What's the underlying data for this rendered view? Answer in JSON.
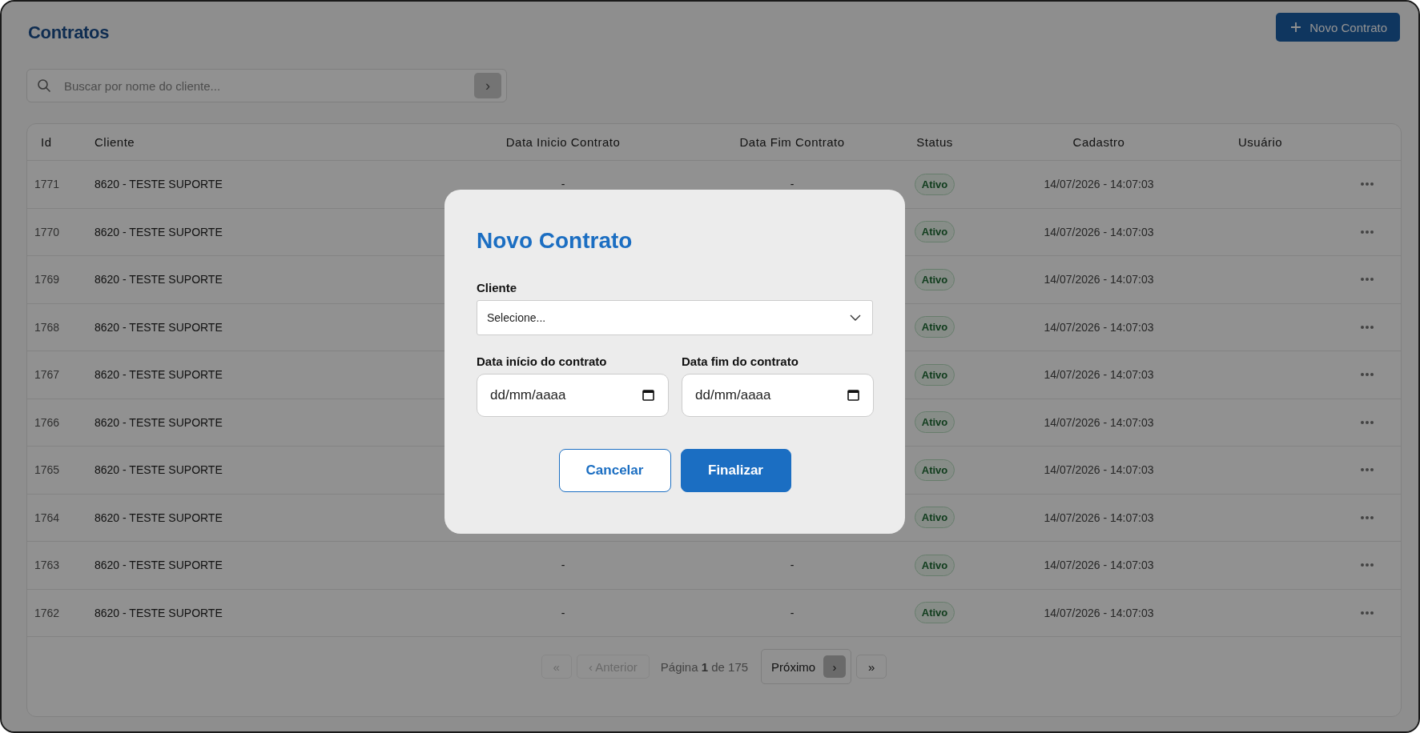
{
  "page": {
    "title": "Contratos",
    "new_button": {
      "label": "Novo Contrato"
    }
  },
  "search": {
    "placeholder": "Buscar por nome do cliente...",
    "go": "›"
  },
  "table": {
    "columns": [
      "Id",
      "Cliente",
      "Data Inicio Contrato",
      "Data Fim Contrato",
      "Status",
      "Cadastro",
      "Usuário"
    ],
    "rows": [
      {
        "id": "1771",
        "cliente": "8620 - TESTE SUPORTE",
        "inicio": "-",
        "fim": "-",
        "status": "Ativo",
        "cadastro": "14/07/2026 - 14:07:03"
      },
      {
        "id": "1770",
        "cliente": "8620 - TESTE SUPORTE",
        "status": "Ativo",
        "cadastro": "14/07/2026 - 14:07:03"
      },
      {
        "id": "1769",
        "cliente": "8620 - TESTE SUPORTE",
        "status": "Ativo",
        "cadastro": "14/07/2026 - 14:07:03"
      },
      {
        "id": "1768",
        "cliente": "8620 - TESTE SUPORTE",
        "status": "Ativo",
        "cadastro": "14/07/2026 - 14:07:03"
      },
      {
        "id": "1767",
        "cliente": "8620 - TESTE SUPORTE",
        "status": "Ativo",
        "cadastro": "14/07/2026 - 14:07:03"
      },
      {
        "id": "1766",
        "cliente": "8620 - TESTE SUPORTE",
        "status": "Ativo",
        "cadastro": "14/07/2026 - 14:07:03"
      },
      {
        "id": "1765",
        "cliente": "8620 - TESTE SUPORTE",
        "status": "Ativo",
        "cadastro": "14/07/2026 - 14:07:03"
      },
      {
        "id": "1764",
        "cliente": "8620 - TESTE SUPORTE",
        "status": "Ativo",
        "cadastro": "14/07/2026 - 14:07:03"
      },
      {
        "id": "1763",
        "cliente": "8620 - TESTE SUPORTE",
        "inicio": "-",
        "fim": "-",
        "status": "Ativo",
        "cadastro": "14/07/2026 - 14:07:03"
      },
      {
        "id": "1762",
        "cliente": "8620 - TESTE SUPORTE",
        "inicio": "-",
        "fim": "-",
        "status": "Ativo",
        "cadastro": "14/07/2026 - 14:07:03"
      }
    ]
  },
  "pagination": {
    "first": {
      "label": "«",
      "disabled": true
    },
    "previous": {
      "icon": "‹",
      "label": "Anterior",
      "disabled": true
    },
    "info": "Página **1** de 175",
    "next": {
      "label": "Próximo",
      "icon": "›",
      "disabled": false
    },
    "last": {
      "label": "»",
      "disabled": false
    }
  },
  "modal": {
    "title": "Novo Contrato",
    "client": {
      "label": "Cliente",
      "value": "Selecione..."
    },
    "start_date": {
      "label": "Data início do contrato",
      "placeholder": "dd/mm/aaaa"
    },
    "end_date": {
      "label": "Data fim do contrato",
      "placeholder": "dd/mm/aaaa"
    },
    "buttons": [
      {
        "label": "Cancelar",
        "kind": "secondary"
      },
      {
        "label": "Finalizar",
        "kind": "primary"
      }
    ]
  }
}
